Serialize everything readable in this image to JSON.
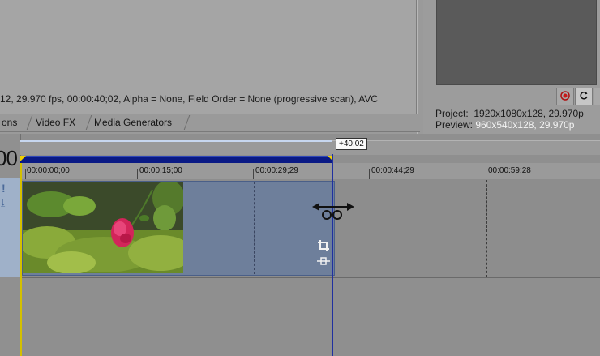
{
  "media_info": {
    "text": "12, 29.970 fps, 00:00:40;02, Alpha = None, Field Order = None (progressive scan), AVC"
  },
  "tabs": [
    {
      "label": "ons"
    },
    {
      "label": "Video FX"
    },
    {
      "label": "Media Generators"
    }
  ],
  "preview": {
    "project_label": "Project:",
    "project_value": "1920x1080x128, 29.970p",
    "preview_label": "Preview:",
    "preview_value": "960x540x128, 29.970p",
    "buttons": [
      {
        "icon": "record-icon"
      },
      {
        "icon": "refresh-icon"
      },
      {
        "icon": "split-icon"
      }
    ]
  },
  "timeline": {
    "time_display": "00",
    "loop_label": "+40;02",
    "ruler_labels": [
      "00:00:00;00",
      "00:00:15;00",
      "00:00:29;29",
      "00:00:44;29",
      "00:00:59;28"
    ],
    "track_icons": [
      "!",
      "⤓"
    ]
  },
  "colors": {
    "selection_bar": "#0a1a85",
    "event_fill": "#6e7f9b",
    "accent_yellow": "#f0d000"
  }
}
